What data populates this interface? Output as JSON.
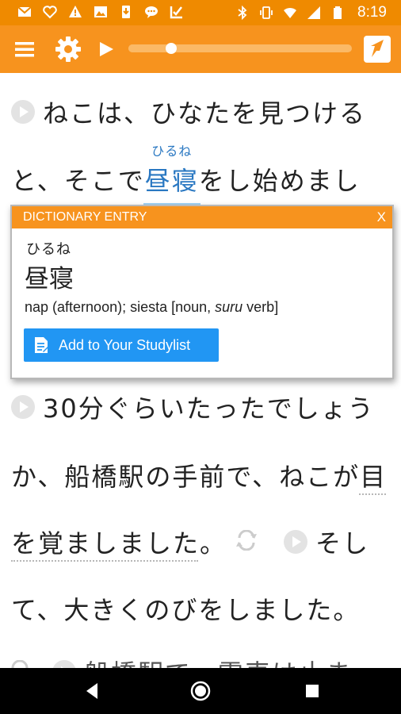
{
  "status_bar": {
    "time": "8:19",
    "left_icons": [
      "mail-icon",
      "heart-icon",
      "warning-icon",
      "image-icon",
      "download-icon",
      "chat-icon",
      "check-icon"
    ],
    "right_icons": [
      "bluetooth-icon",
      "vibrate-icon",
      "wifi-icon",
      "signal-icon",
      "battery-icon"
    ]
  },
  "toolbar": {
    "icons": [
      "menu-icon",
      "settings-icon",
      "play-icon",
      "share-icon"
    ],
    "progress_fraction": 0.19
  },
  "reader": {
    "line1": "ねこは、ひなたを見つける",
    "line2_before": "と、そこで",
    "line2_word": "昼寝",
    "line2_furigana": "ひるね",
    "line2_after": "をし始めまし",
    "line3": "30分ぐらいたったでしょう",
    "line4": "か、船橋駅の手前で、ねこが目",
    "line5_a": "を覚ましました。",
    "line5_b": "そし",
    "line6": "て、大きくのびをしました。",
    "line7": "船橋駅で、電車は止ま"
  },
  "dictionary": {
    "header": "DICTIONARY ENTRY",
    "close": "X",
    "reading": "ひるね",
    "word": "昼寝",
    "definition_start": "nap (afternoon); siesta [noun, ",
    "definition_italic": "suru",
    "definition_end": " verb]",
    "button_label": "Add to Your Studylist"
  },
  "colors": {
    "status_bar": "#ef8a00",
    "toolbar": "#f7931e",
    "highlight": "#2a78c2",
    "button": "#2196f3"
  }
}
